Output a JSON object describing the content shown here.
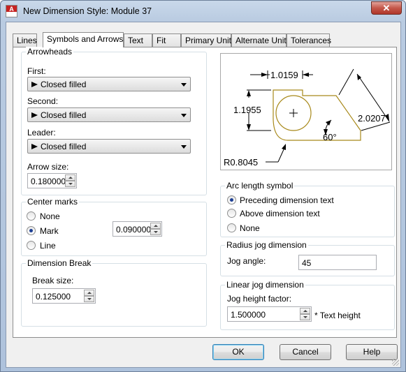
{
  "window": {
    "title": "New Dimension Style: Module 37",
    "close_label": "✕"
  },
  "tabs": [
    "Lines",
    "Symbols and Arrows",
    "Text",
    "Fit",
    "Primary Units",
    "Alternate Units",
    "Tolerances"
  ],
  "arrowheads": {
    "group_label": "Arrowheads",
    "first_label": "First:",
    "first_value": "Closed filled",
    "second_label": "Second:",
    "second_value": "Closed filled",
    "leader_label": "Leader:",
    "leader_value": "Closed filled",
    "arrow_size_label": "Arrow size:",
    "arrow_size_value": "0.180000"
  },
  "center_marks": {
    "group_label": "Center marks",
    "options": [
      "None",
      "Mark",
      "Line"
    ],
    "selected": "Mark",
    "size_value": "0.090000"
  },
  "dimension_break": {
    "group_label": "Dimension Break",
    "break_size_label": "Break size:",
    "break_size_value": "0.125000"
  },
  "preview": {
    "dim_top": "1.0159",
    "dim_left": "1.1955",
    "dim_right": "2.0207",
    "angle": "60°",
    "radius": "R0.8045"
  },
  "arc_length_symbol": {
    "group_label": "Arc length symbol",
    "options": [
      "Preceding dimension text",
      "Above dimension text",
      "None"
    ],
    "selected": "Preceding dimension text"
  },
  "radius_jog": {
    "group_label": "Radius jog dimension",
    "jog_angle_label": "Jog angle:",
    "jog_angle_value": "45"
  },
  "linear_jog": {
    "group_label": "Linear jog dimension",
    "jog_height_label": "Jog height factor:",
    "jog_height_value": "1.500000",
    "suffix": "* Text height"
  },
  "buttons": {
    "ok": "OK",
    "cancel": "Cancel",
    "help": "Help"
  },
  "colors": {
    "accent": "#1c3f94",
    "preview_geometry": "#a8891a"
  }
}
